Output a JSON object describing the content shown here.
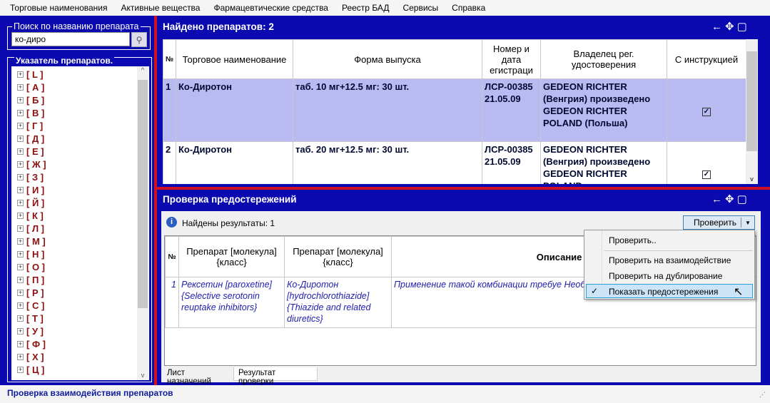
{
  "menu": [
    "Торговые наименования",
    "Активные вещества",
    "Фармацевтические средства",
    "Реестр БАД",
    "Сервисы",
    "Справка"
  ],
  "search": {
    "legend": "Поиск по названию препарата",
    "value": "ко-диро"
  },
  "tree": {
    "label": "Указатель препаратов.",
    "items": [
      "[ L ]",
      "[ А ]",
      "[ Б ]",
      "[ В ]",
      "[ Г ]",
      "[ Д ]",
      "[ Е ]",
      "[ Ж ]",
      "[ З ]",
      "[ И ]",
      "[ Й ]",
      "[ К ]",
      "[ Л ]",
      "[ М ]",
      "[ Н ]",
      "[ О ]",
      "[ П ]",
      "[ Р ]",
      "[ С ]",
      "[ Т ]",
      "[ У ]",
      "[ Ф ]",
      "[ Х ]",
      "[ Ц ]"
    ]
  },
  "found": {
    "title": "Найдено препаратов: 2",
    "columns": [
      "№",
      "Торговое наименование",
      "Форма выпуска",
      "Номер и дата егистраци",
      "Владелец рег. удостоверения",
      "С инструкцией"
    ],
    "rows": [
      {
        "n": "1",
        "name": "Ко-Диротон",
        "form": "таб. 10 мг+12.5 мг: 30 шт.",
        "reg": "ЛСР-00385 21.05.09",
        "owner": " GEDEON RICHTER (Венгрия) произведено GEDEON RICHTER POLAND (Польша)",
        "instr": true
      },
      {
        "n": "2",
        "name": "Ко-Диротон",
        "form": "таб. 20 мг+12.5 мг: 30 шт.",
        "reg": "ЛСР-00385 21.05.09",
        "owner": " GEDEON RICHTER (Венгрия) произведено GEDEON RICHTER POLAND",
        "instr": true
      }
    ]
  },
  "check": {
    "title": "Проверка предостережений",
    "results": "Найдены результаты: 1",
    "button": "Проверить",
    "columns": [
      "№",
      "Препарат [молекула] {класс}",
      "Препарат [молекула] {класс}",
      "Описание предо"
    ],
    "rows": [
      {
        "n": "1",
        "a": "Рексетин [paroxetine] {Selective serotonin reuptake inhibitors}",
        "b": "Ко-Диротон [hydrochlorothiazide] {Thiazide and related diuretics}",
        "desc": " Применение такой комбинации требуе Необходимо наблюдать за клиническим"
      }
    ],
    "menu": [
      "Проверить..",
      "Проверить на взаимодействие",
      "Проверить на дублирование",
      "Показать предостережения"
    ],
    "tabs": [
      "Лист назначений",
      "Результат проверки"
    ]
  },
  "status": "Проверка взаимодействия препаратов"
}
